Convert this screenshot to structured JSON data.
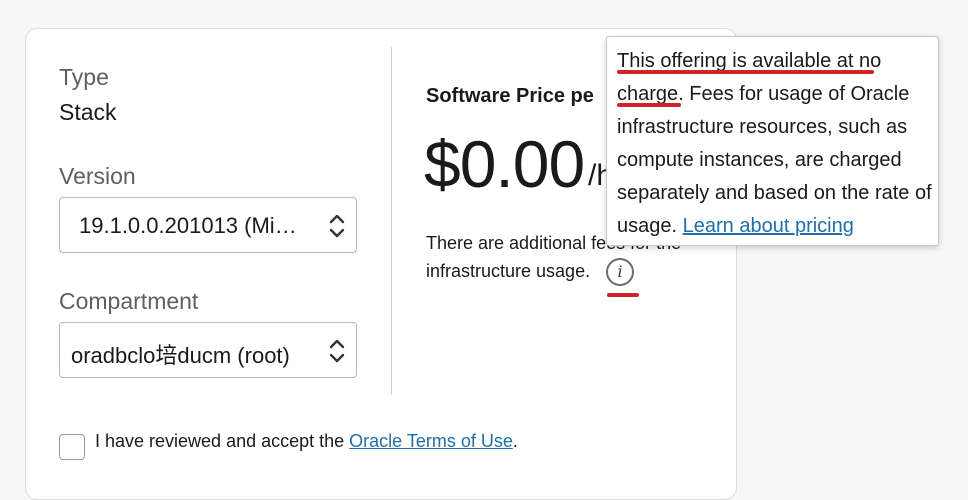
{
  "left": {
    "type_label": "Type",
    "type_value": "Stack",
    "version_label": "Version",
    "version_value": "19.1.0.0.201013 (Mi…",
    "compartment_label": "Compartment",
    "compartment_value": "oradbclo培ducm (root)"
  },
  "price": {
    "heading": "Software Price pe",
    "amount": "$0.00",
    "unit": "/h",
    "fees_text": "There are additional fees for the infrastructure usage."
  },
  "tooltip": {
    "text_before_link": "This offering is available at no charge. Fees for usage of Oracle infrastructure resources, such as compute instances, are charged separately and based on the rate of usage.",
    "link_text": "Learn about pricing"
  },
  "terms": {
    "prefix": "I have reviewed and accept the ",
    "link_text": "Oracle Terms of Use",
    "suffix": "."
  },
  "icons": {
    "info": "i",
    "select_chevron": "chevron-up-down-icon"
  },
  "colors": {
    "link": "#1f6fa8",
    "annotation_red": "#d0232a"
  }
}
